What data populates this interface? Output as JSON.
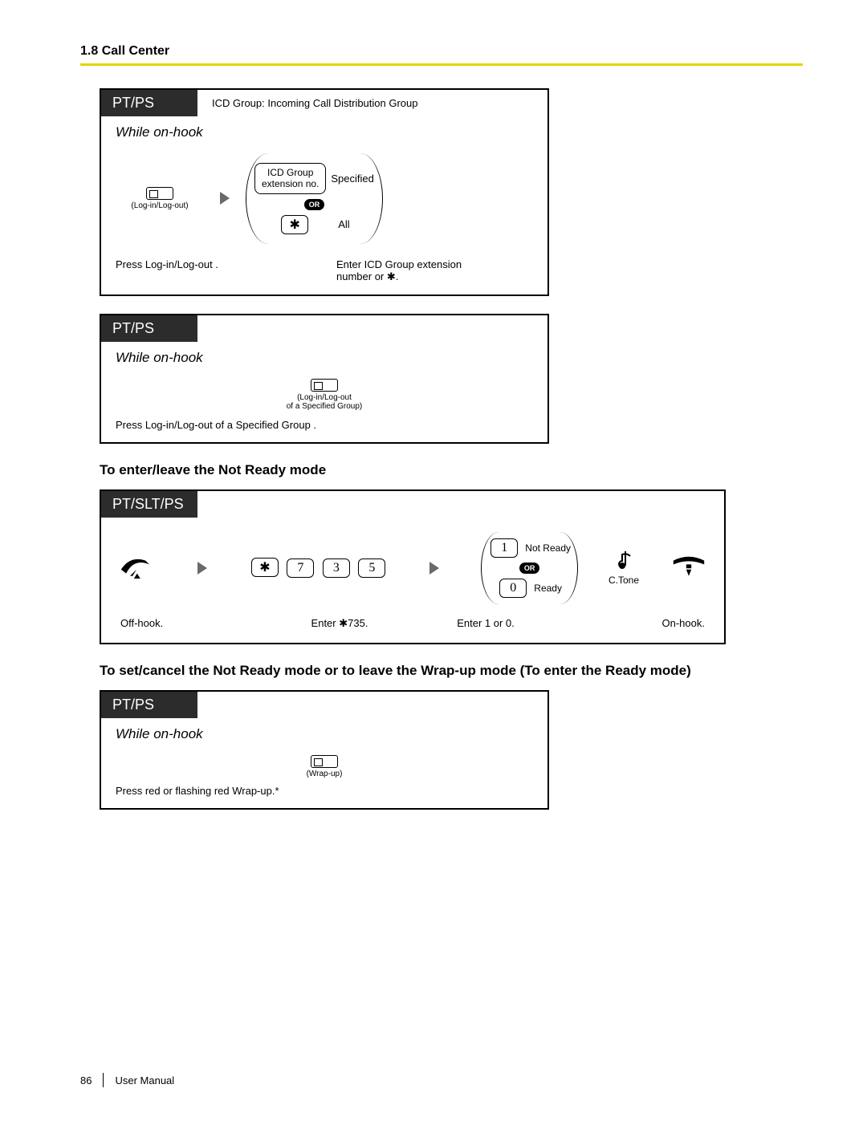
{
  "header": {
    "section": "1.8 Call Center"
  },
  "box1": {
    "tab": "PT/PS",
    "tab_note": "ICD Group: Incoming Call Distribution Group",
    "condition": "While on-hook",
    "button_caption": "(Log-in/Log-out)",
    "ext_box_line1": "ICD Group",
    "ext_box_line2": "extension no.",
    "specified": "Specified",
    "or": "OR",
    "star": "✱",
    "all": "All",
    "instr_left": "Press Log-in/Log-out  .",
    "instr_right_a": "Enter ICD Group extension",
    "instr_right_b": "number  or  ✱."
  },
  "box2": {
    "tab": "PT/PS",
    "condition": "While on-hook",
    "button_caption_a": "(Log-in/Log-out",
    "button_caption_b": "of a Specified Group)",
    "instr": "Press Log-in/Log-out of a Specified Group    ."
  },
  "heading1": "To enter/leave the Not Ready mode",
  "box3": {
    "tab": "PT/SLT/PS",
    "keys": {
      "k0": "✱",
      "k1": "7",
      "k2": "3",
      "k3": "5"
    },
    "opt1_key": "1",
    "opt1_label": "Not Ready",
    "or": "OR",
    "opt0_key": "0",
    "opt0_label": "Ready",
    "ctone": "C.Tone",
    "instr_offhook": "Off-hook.",
    "instr_enter735": "Enter  ✱735.",
    "instr_enter10": "Enter 1 or 0.",
    "instr_onhook": "On-hook."
  },
  "heading2": "To set/cancel the Not Ready mode or to leave the Wrap-up mode (To enter the Ready mode)",
  "box4": {
    "tab": "PT/PS",
    "condition": "While on-hook",
    "button_caption": "(Wrap-up)",
    "instr": "Press red or flashing red Wrap-up.*"
  },
  "footer": {
    "page": "86",
    "doc": "User Manual"
  }
}
